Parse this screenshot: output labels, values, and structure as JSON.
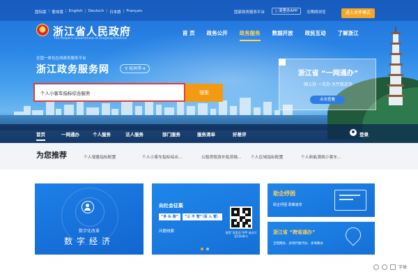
{
  "top_bar": {
    "languages": [
      "国际版",
      "繁体版",
      "English",
      "Deutsch",
      "日本語",
      "Français"
    ],
    "platform_link": "国家政务服务平台",
    "app_download": "浙里办APP",
    "accessibility": "无障碍浏览",
    "elder_mode": "进入关怀模式"
  },
  "site": {
    "title": "浙江省人民政府",
    "subtitle": "The People's Government of Zhejiang Province"
  },
  "main_nav": {
    "items": [
      "首 页",
      "政务公开",
      "政务服务",
      "数据开放",
      "政民互动",
      "了解浙江"
    ],
    "active_index": 2
  },
  "portal": {
    "subtitle": "全国一体化在线政务服务平台",
    "title": "浙江政务服务网",
    "city": "杭州市"
  },
  "search": {
    "value": "个人小客车指标综合服务",
    "button": "搜索"
  },
  "promo": {
    "title": "浙江省 “一网通办”",
    "subtitle": "网上办 一次办 大厅就近办",
    "button": "点击查看"
  },
  "sub_nav": {
    "items": [
      "首页",
      "一网通办",
      "个人服务",
      "法人服务",
      "部门服务",
      "服务清单",
      "好差评"
    ],
    "active_index": 0,
    "login": "登录"
  },
  "recommend": {
    "heading": "为您推荐",
    "items": [
      "个人增量指标配置",
      "个人小客车指标综合...",
      "公租房租赁补贴资格...",
      "个人区域指标配置",
      "个人新能源类小客车..."
    ]
  },
  "cards": {
    "digital_economy": {
      "subtitle": "数字化改革",
      "title": "数字经济"
    },
    "solicitation": {
      "title": "向社会征集",
      "chip1": "“多 头 跑”",
      "chip2": "“三 不 管”（深 入 管）",
      "survey": "问题线索",
      "qr_caption": "使用“浙里办”APP 或支付宝扫码参与"
    },
    "enterprise_aid": {
      "title": "助企纾困",
      "subtitle": "助企纾困 政策速享"
    },
    "cross_province": {
      "title": "浙江省 “跨省通办”",
      "subtitle": "全程网办、异地代收代办、多地联办"
    }
  },
  "floating_tools": {
    "font_label": "字体"
  },
  "colors": {
    "brand_blue": "#1f6ed8",
    "search_border": "#e23a3a",
    "search_button": "#f29a13",
    "elder_button": "#f5a623",
    "accent_yellow": "#ffd25a"
  }
}
